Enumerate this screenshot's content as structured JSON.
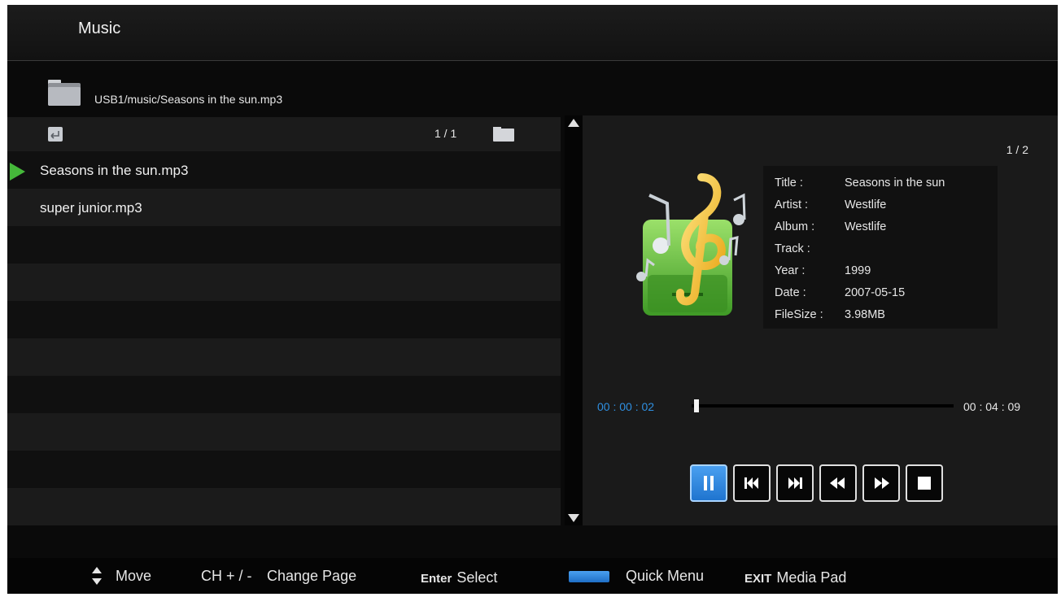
{
  "header": {
    "title": "Music"
  },
  "path": {
    "text": "USB1/music/Seasons in the sun.mp3"
  },
  "list": {
    "page_indicator": "1 / 1",
    "items": [
      {
        "name": "Seasons in the sun.mp3",
        "playing": true
      },
      {
        "name": "super junior.mp3",
        "playing": false
      }
    ]
  },
  "player": {
    "track_counter": "1 / 2",
    "info": {
      "title_label": "Title :",
      "title_value": "Seasons in the sun",
      "artist_label": "Artist :",
      "artist_value": "Westlife",
      "album_label": "Album :",
      "album_value": "Westlife",
      "track_label": "Track :",
      "track_value": "",
      "year_label": "Year :",
      "year_value": "1999",
      "date_label": "Date :",
      "date_value": "2007-05-15",
      "filesize_label": "FileSize :",
      "filesize_value": "3.98MB"
    },
    "time_elapsed": "00 : 00 : 02",
    "time_total": "00 : 04 : 09",
    "progress_fraction": 0.008,
    "controls": [
      "pause-icon",
      "prev-track-icon",
      "next-track-icon",
      "rewind-icon",
      "fast-forward-icon",
      "stop-icon"
    ]
  },
  "footer": {
    "move_label": "Move",
    "ch_key": "CH + / -",
    "change_page_label": "Change Page",
    "enter_key": "Enter",
    "select_label": "Select",
    "quick_menu_label": "Quick Menu",
    "exit_key": "EXIT",
    "media_pad_label": "Media Pad"
  },
  "colors": {
    "accent_blue": "#2f8fe0",
    "play_marker_green": "#45b83a",
    "background": "#0a0a0a"
  }
}
